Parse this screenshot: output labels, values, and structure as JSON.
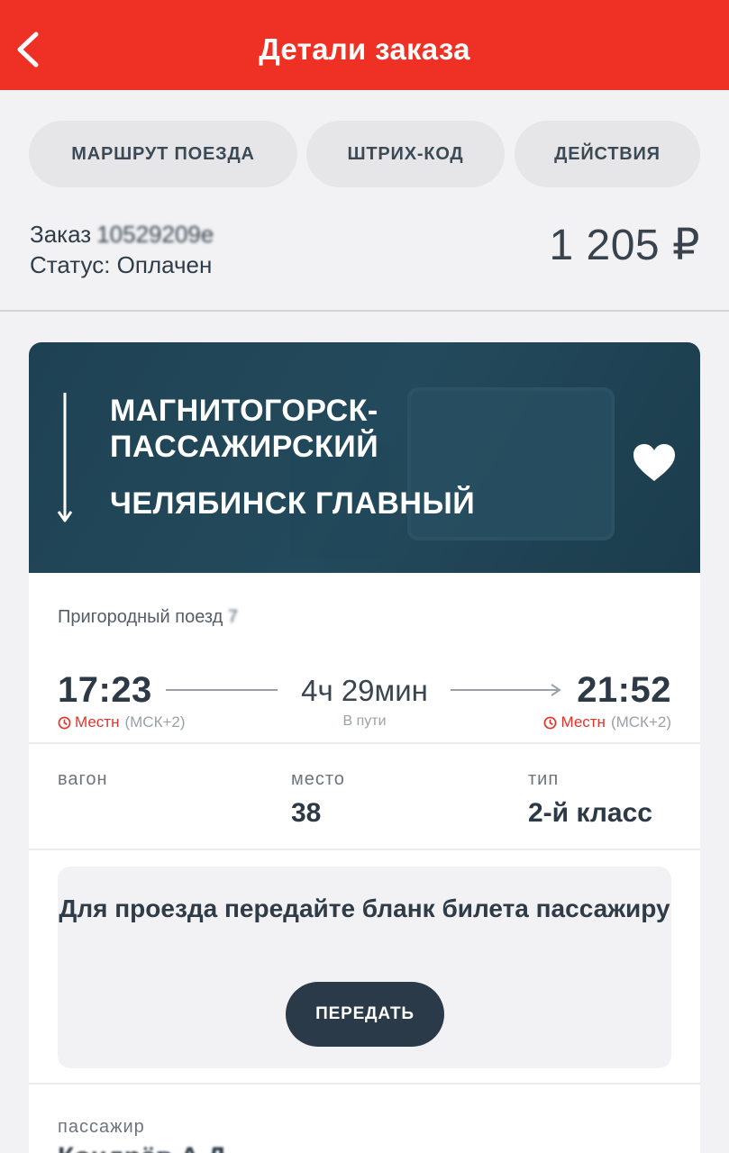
{
  "header": {
    "title": "Детали заказа",
    "back_icon": "chevron-left-icon",
    "background_color": "#ee3124"
  },
  "tabs": [
    {
      "label": "МАРШРУТ ПОЕЗДА"
    },
    {
      "label": "ШТРИХ-КОД"
    },
    {
      "label": "ДЕЙСТВИЯ"
    }
  ],
  "order": {
    "label": "Заказ",
    "number": "10529209е",
    "status_label": "Статус: Оплачен",
    "price": "1 205 ₽"
  },
  "route": {
    "from": "МАГНИТОГОРСК-ПАССАЖИРСКИЙ",
    "to": "ЧЕЛЯБИНСК ГЛАВНЫЙ",
    "favorite_icon": "heart-icon",
    "hero_color": "#1f4455"
  },
  "train": {
    "name": "Пригородный поезд",
    "number": "7"
  },
  "schedule": {
    "departure_time": "17:23",
    "arrival_time": "21:52",
    "duration": "4ч 29мин",
    "in_transit_label": "В пути",
    "local_label": "Местн",
    "tz_offset": "(МСК+2)",
    "local_color": "#e3342c"
  },
  "seat_info": {
    "car_label": "вагон",
    "car_value": "",
    "seat_label": "место",
    "seat_value": "38",
    "type_label": "тип",
    "type_value": "2-й класс"
  },
  "notice": {
    "text": "Для проезда передайте бланк билета пассажиру",
    "button_label": "ПЕРЕДАТЬ"
  },
  "passenger": {
    "label": "пассажир",
    "name": "Кондрёв А.Д."
  }
}
